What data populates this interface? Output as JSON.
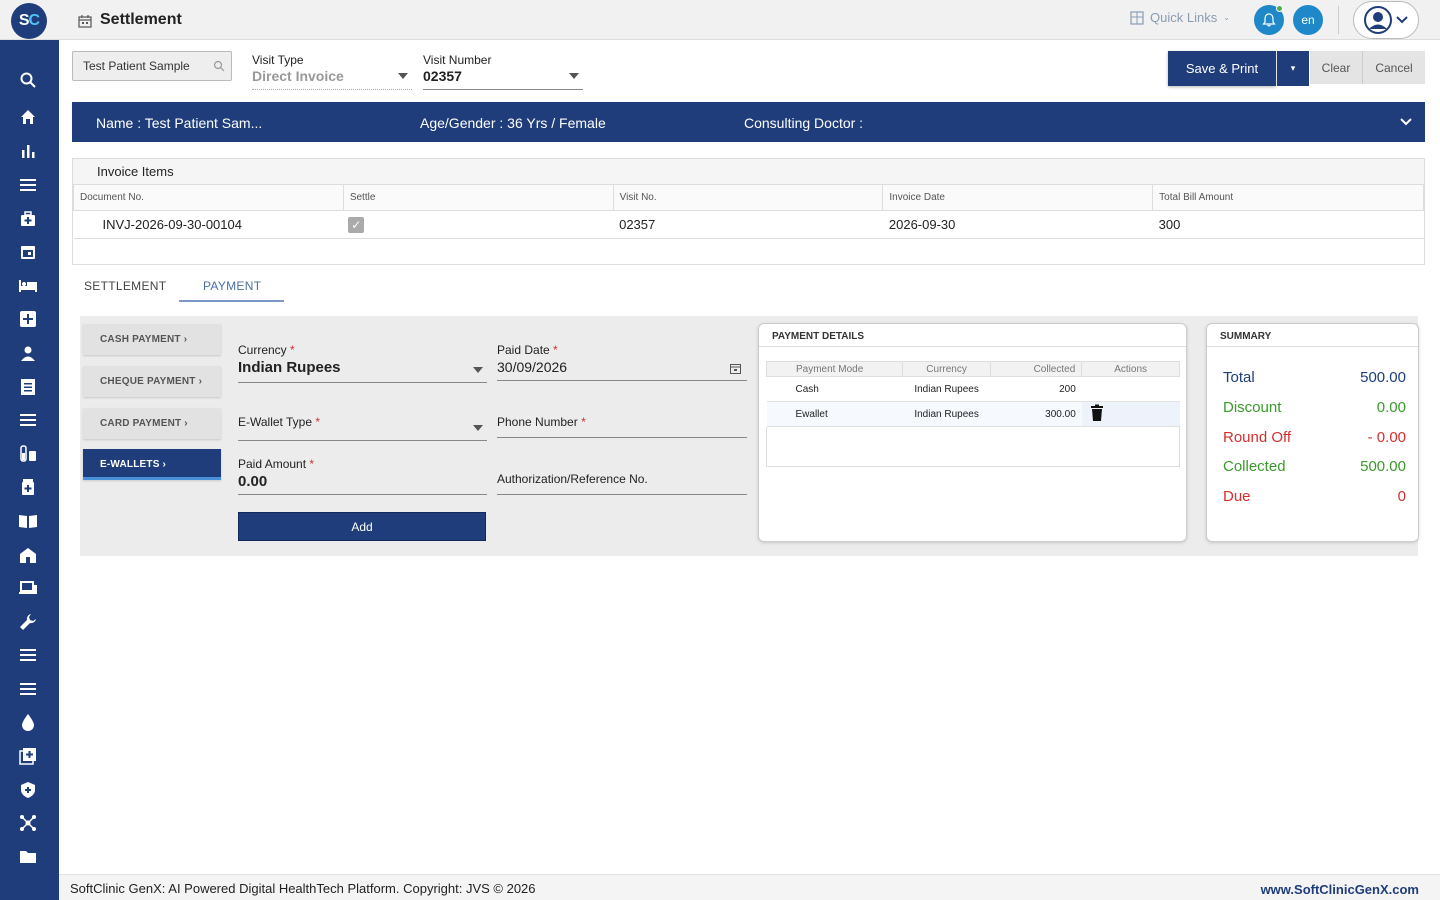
{
  "app": {
    "logo_s": "S",
    "logo_c": "C",
    "page_title": "Settlement",
    "quick_links": "Quick Links",
    "lang": "en"
  },
  "toolbar": {
    "patient_search_value": "Test Patient Sample",
    "visit_type_label": "Visit Type",
    "visit_type_value": "Direct Invoice",
    "visit_number_label": "Visit Number",
    "visit_number_value": "02357",
    "save_print_label": "Save & Print",
    "clear_label": "Clear",
    "cancel_label": "Cancel"
  },
  "banner": {
    "name": "Name :  Test Patient Sam...",
    "age_gender": "Age/Gender :  36 Yrs / Female",
    "doctor": "Consulting Doctor :"
  },
  "invoice": {
    "title": "Invoice Items",
    "columns": [
      "Document No.",
      "Settle",
      "Visit No.",
      "Invoice Date",
      "Total Bill Amount"
    ],
    "rows": [
      {
        "document_no": "INVJ-2026-09-30-00104",
        "settle": true,
        "visit_no": "02357",
        "invoice_date": "2026-09-30",
        "total": "300"
      }
    ]
  },
  "tabs": {
    "settlement": "SETTLEMENT",
    "payment": "PAYMENT"
  },
  "payment_modes": [
    "CASH PAYMENT ›",
    "CHEQUE PAYMENT ›",
    "CARD PAYMENT ›",
    "E-WALLETS ›"
  ],
  "form": {
    "currency_label": "Currency",
    "currency_value": "Indian Rupees",
    "paid_date_label": "Paid Date",
    "paid_date_value": "30/09/2026",
    "ewallet_label": "E-Wallet Type",
    "phone_label": "Phone Number",
    "paid_amount_label": "Paid Amount",
    "paid_amount_value": "0.00",
    "auth_label": "Authorization/Reference No.",
    "required_mark": "*",
    "add_label": "Add"
  },
  "payment_details": {
    "title": "PAYMENT DETAILS",
    "columns": [
      "Payment Mode",
      "Currency",
      "Collected",
      "Actions"
    ],
    "rows": [
      {
        "mode": "Cash",
        "currency": "Indian Rupees",
        "collected": "200"
      },
      {
        "mode": "Ewallet",
        "currency": "Indian Rupees",
        "collected": "300.00"
      }
    ]
  },
  "summary": {
    "title": "SUMMARY",
    "rows": [
      {
        "label": "Total",
        "value": "500.00",
        "color": "#1f3d7a"
      },
      {
        "label": "Discount",
        "value": "0.00",
        "color": "#3a9a2a"
      },
      {
        "label": "Round Off",
        "value": "- 0.00",
        "color": "#d32f2f"
      },
      {
        "label": "Collected",
        "value": "500.00",
        "color": "#3a9a2a"
      },
      {
        "label": "Due",
        "value": "0",
        "color": "#d32f2f"
      }
    ]
  },
  "footer": {
    "left": "SoftClinic GenX: AI Powered Digital HealthTech Platform. Copyright: JVS © 2026",
    "right": "www.SoftClinicGenX.com"
  },
  "sidebar_icons": [
    "search-icon",
    "home-icon",
    "bar-chart-icon",
    "menu-icon",
    "medical-bag-icon",
    "calendar-icon",
    "bed-icon",
    "plus-box-icon",
    "person-icon",
    "receipt-icon",
    "list-icon",
    "lab-icon",
    "pharmacy-icon",
    "book-icon",
    "hospital-icon",
    "devices-icon",
    "wrench-icon",
    "menu-icon",
    "menu-icon",
    "drop-icon",
    "add-copy-icon",
    "shield-icon",
    "network-icon",
    "folder-icon"
  ],
  "colors": {
    "brand": "#1f3d7a",
    "accent": "#1e88c8"
  }
}
